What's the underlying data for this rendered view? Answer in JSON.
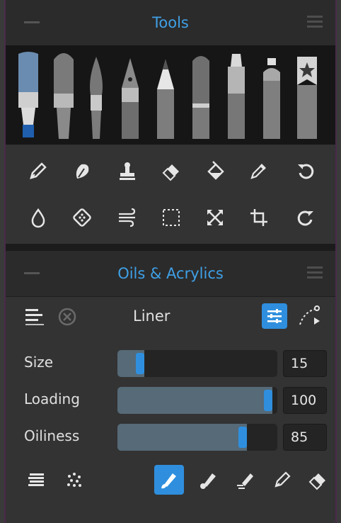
{
  "tools_panel": {
    "title": "Tools",
    "brushes": [
      "flat-brush-icon",
      "round-brush-icon",
      "fan-brush-icon",
      "fountain-pen-icon",
      "pencil-icon",
      "palette-knife-icon",
      "marker-icon",
      "spray-can-icon",
      "favorites-bookmark-icon"
    ],
    "selected_brush": "flat-brush-icon",
    "tool_rows": [
      [
        "pencil-tool-icon",
        "smudge-icon",
        "stamp-icon",
        "eraser-icon",
        "fill-bucket-icon",
        "eyedropper-icon",
        "undo-icon"
      ],
      [
        "water-drop-icon",
        "sticker-icon",
        "blower-icon",
        "selection-icon",
        "transform-icon",
        "crop-icon",
        "redo-icon"
      ]
    ]
  },
  "oils_panel": {
    "title": "Oils & Acrylics",
    "preset_name": "Liner",
    "sliders": [
      {
        "label": "Size",
        "value": "15",
        "fraction": 0.17
      },
      {
        "label": "Loading",
        "value": "100",
        "fraction": 0.97
      },
      {
        "label": "Oiliness",
        "value": "85",
        "fraction": 0.81
      }
    ],
    "bottom_tools": [
      "paint-brush-icon",
      "smudge-brush-icon",
      "blend-brush-icon",
      "clean-brush-icon",
      "eraser-icon"
    ],
    "active_bottom_tool": "paint-brush-icon"
  },
  "colors": {
    "accent": "#3fa0e6",
    "active": "#2f8fde"
  }
}
